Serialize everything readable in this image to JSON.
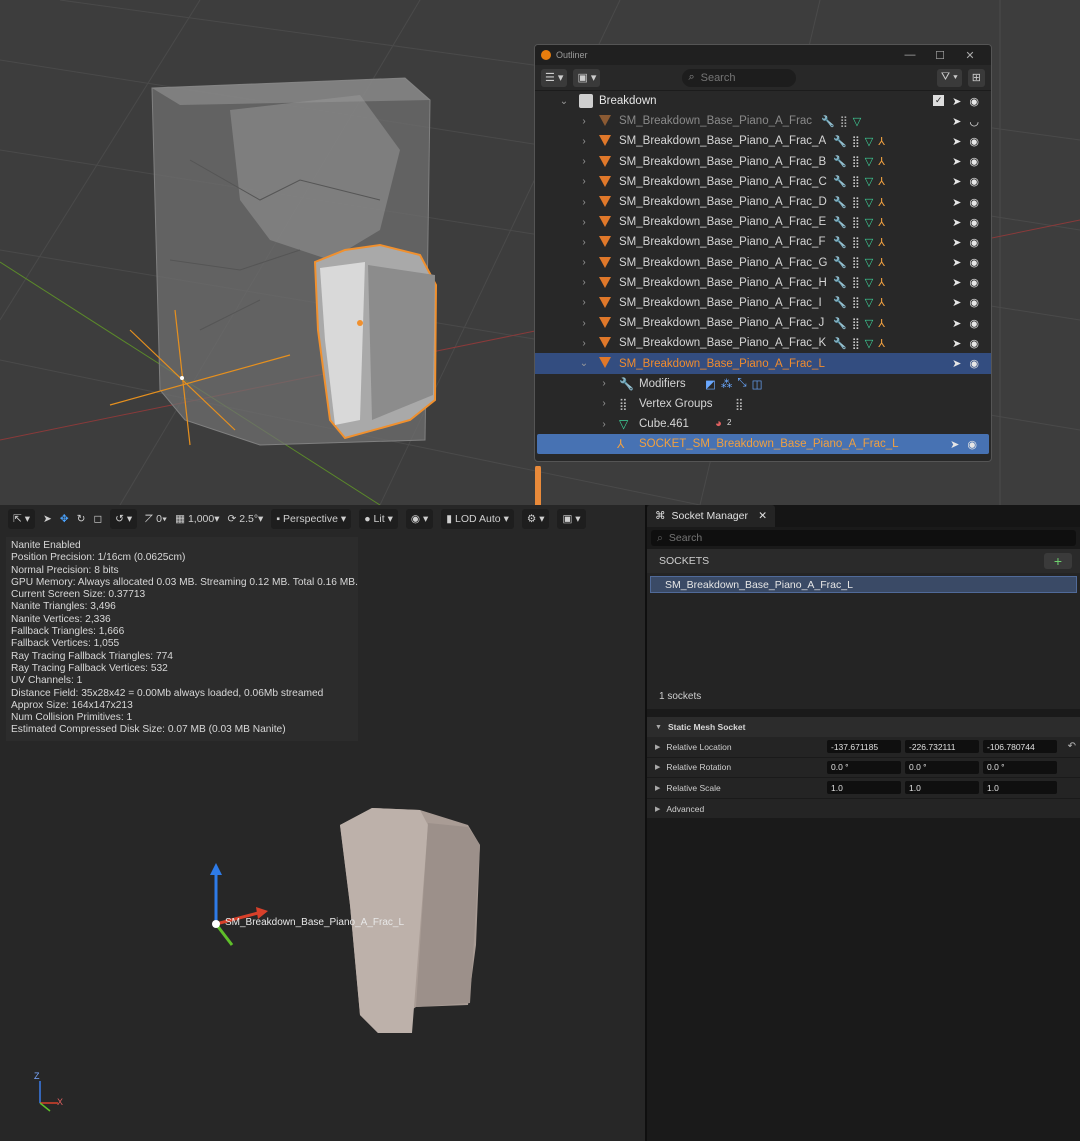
{
  "outliner": {
    "title": "Outliner",
    "search_placeholder": "Search",
    "collection": "Breakdown",
    "objects": [
      "SM_Breakdown_Base_Piano_A_Frac",
      "SM_Breakdown_Base_Piano_A_Frac_A",
      "SM_Breakdown_Base_Piano_A_Frac_B",
      "SM_Breakdown_Base_Piano_A_Frac_C",
      "SM_Breakdown_Base_Piano_A_Frac_D",
      "SM_Breakdown_Base_Piano_A_Frac_E",
      "SM_Breakdown_Base_Piano_A_Frac_F",
      "SM_Breakdown_Base_Piano_A_Frac_G",
      "SM_Breakdown_Base_Piano_A_Frac_H",
      "SM_Breakdown_Base_Piano_A_Frac_I",
      "SM_Breakdown_Base_Piano_A_Frac_J",
      "SM_Breakdown_Base_Piano_A_Frac_K",
      "SM_Breakdown_Base_Piano_A_Frac_L"
    ],
    "children": {
      "modifiers": "Modifiers",
      "vertex_groups": "Vertex Groups",
      "mesh": "Cube.461",
      "material_count": "2",
      "socket": "SOCKET_SM_Breakdown_Base_Piano_A_Frac_L"
    }
  },
  "ue_toolbar": {
    "fov_value": "0",
    "grid_value": "1,000",
    "rot_value": "2.5°",
    "view_mode": "Perspective",
    "lit_mode": "Lit",
    "lod_mode": "LOD Auto"
  },
  "ue_stats": [
    "Nanite Enabled",
    "Position Precision: 1/16cm (0.0625cm)",
    "Normal Precision: 8 bits",
    "GPU Memory: Always allocated 0.03 MB. Streaming 0.12 MB. Total 0.16 MB.",
    "Current Screen Size:  0.37713",
    "Nanite Triangles:  3,496",
    "Nanite Vertices:  2,336",
    "Fallback Triangles:  1,666",
    "Fallback Vertices:  1,055",
    "Ray Tracing Fallback Triangles:  774",
    "Ray Tracing Fallback Vertices:  532",
    "UV Channels:  1",
    "Distance Field:  35x28x42 = 0.00Mb always loaded, 0.06Mb streamed",
    "Approx Size: 164x147x213",
    "Num Collision Primitives:  1",
    "Estimated Compressed Disk Size: 0.07 MB (0.03 MB Nanite)"
  ],
  "ue_viewport": {
    "socket_label": "SM_Breakdown_Base_Piano_A_Frac_L",
    "axis_z": "Z",
    "axis_x": "X"
  },
  "socket_manager": {
    "tab_title": "Socket Manager",
    "search_placeholder": "Search",
    "sockets_header": "SOCKETS",
    "socket_item": "SM_Breakdown_Base_Piano_A_Frac_L",
    "count": "1 sockets",
    "section_title": "Static Mesh Socket",
    "props": [
      {
        "name": "Relative Location",
        "values": [
          "-137.671185",
          "-226.732111",
          "-106.780744"
        ]
      },
      {
        "name": "Relative Rotation",
        "values": [
          "0.0 °",
          "0.0 °",
          "0.0 °"
        ]
      },
      {
        "name": "Relative Scale",
        "values": [
          "1.0",
          "1.0",
          "1.0"
        ]
      }
    ],
    "advanced": "Advanced"
  },
  "colors": {
    "selection_orange": "#f08c2e",
    "active_row": "#4772b3",
    "socket_item_bg": "#3a4a66",
    "add_green": "#6fd16f"
  }
}
